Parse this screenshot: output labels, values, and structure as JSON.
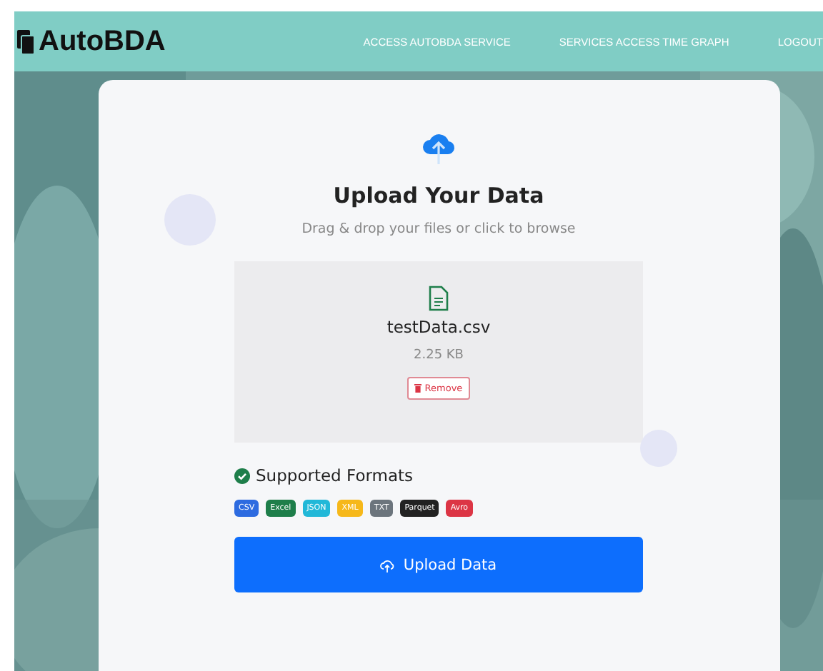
{
  "header": {
    "logo": "AutoBDA",
    "nav": [
      "ACCESS AUTOBDA SERVICE",
      "SERVICES ACCESS TIME GRAPH",
      "LOGOUT"
    ]
  },
  "upload": {
    "title": "Upload Your Data",
    "subtitle": "Drag & drop your files or click to browse",
    "file": {
      "name": "testData.csv",
      "size": "2.25 KB",
      "remove": "Remove"
    }
  },
  "formats": {
    "title": "Supported Formats",
    "items": [
      {
        "label": "CSV",
        "color": "#2d6be0"
      },
      {
        "label": "Excel",
        "color": "#1e7e4a"
      },
      {
        "label": "JSON",
        "color": "#22b8d8"
      },
      {
        "label": "XML",
        "color": "#f6b81a"
      },
      {
        "label": "TXT",
        "color": "#6c757d"
      },
      {
        "label": "Parquet",
        "color": "#222222"
      },
      {
        "label": "Avro",
        "color": "#dc3545"
      }
    ]
  },
  "button": "Upload Data"
}
